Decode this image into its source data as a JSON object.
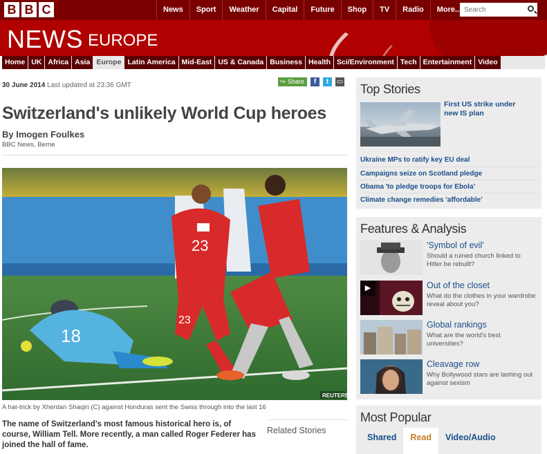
{
  "brand": {
    "letters": [
      "B",
      "B",
      "C"
    ]
  },
  "topnav": [
    "News",
    "Sport",
    "Weather",
    "Capital",
    "Future",
    "Shop",
    "TV",
    "Radio",
    "More..."
  ],
  "search": {
    "placeholder": "Search"
  },
  "masthead": {
    "title": "NEWS",
    "edition": "EUROPE"
  },
  "secnav": {
    "items": [
      "Home",
      "UK",
      "Africa",
      "Asia",
      "Europe",
      "Latin America",
      "Mid-East",
      "US & Canada",
      "Business",
      "Health",
      "Sci/Environment",
      "Tech",
      "Entertainment",
      "Video"
    ],
    "active": "Europe"
  },
  "article": {
    "date": "30 June 2014",
    "updated": "Last updated at 23:36 GMT",
    "share_label": "Share",
    "headline": "Switzerland's unlikely World Cup heroes",
    "byline": "By Imogen Foulkes",
    "byline_sub": "BBC News, Berne",
    "photo_credit": "REUTERS",
    "jersey_numbers": [
      "23",
      "18",
      "23"
    ],
    "caption": "A hat-trick by Xherdan Shaqiri (C) against Honduras sent the Swiss through into the last 16",
    "intro": "The name of Switzerland's most famous historical hero is, of course, William Tell. More recently, a man called Roger Federer has joined the hall of fame.",
    "related_title": "Related Stories"
  },
  "top_stories": {
    "title": "Top Stories",
    "lead": "First US strike under new IS plan",
    "items": [
      "Ukraine MPs to ratify key EU deal",
      "Campaigns seize on Scotland pledge",
      "Obama 'to pledge troops for Ebola'",
      "Climate change remedies 'affordable'"
    ]
  },
  "features": {
    "title": "Features & Analysis",
    "items": [
      {
        "title": "'Symbol of evil'",
        "desc": "Should a ruined church linked to Hitler be rebuilt?"
      },
      {
        "title": "Out of the closet",
        "desc": "What do the clothes in your wardrobe reveal about you?"
      },
      {
        "title": "Global rankings",
        "desc": "What are the world's best universities?"
      },
      {
        "title": "Cleavage row",
        "desc": "Why Bollywood stars are lashing out against sexism"
      }
    ]
  },
  "most_popular": {
    "title": "Most Popular",
    "tabs": [
      "Shared",
      "Read",
      "Video/Audio"
    ],
    "active": "Read"
  },
  "colors": {
    "brand_dark": "#7a0000",
    "brand_red": "#b00000",
    "link": "#1a4f8b",
    "share_green": "#5a9e3f"
  }
}
